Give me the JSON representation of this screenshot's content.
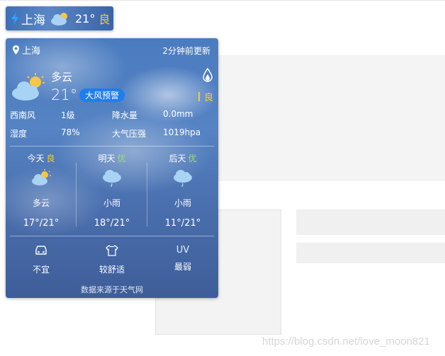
{
  "pill": {
    "city": "上海",
    "temp": "21°",
    "aqi": "良",
    "colors": {
      "aqi": "#f6d026",
      "bolt": "#2aa7ff"
    }
  },
  "card": {
    "location": "上海",
    "updated": "2分钟前更新",
    "condition": "多云",
    "temperature": "21°",
    "warning": "大风预警",
    "aqi": "良",
    "details": [
      {
        "label": "西南风",
        "value": "1级"
      },
      {
        "label": "降水量",
        "value": "0.0mm"
      },
      {
        "label": "湿度",
        "value": "78%"
      },
      {
        "label": "大气压强",
        "value": "1019hpa"
      }
    ],
    "forecast": [
      {
        "day": "今天",
        "quality": "良",
        "icon": "partly-cloudy-icon",
        "condition": "多云",
        "temp": "17°/21°"
      },
      {
        "day": "明天",
        "quality": "优",
        "icon": "light-rain-icon",
        "condition": "小雨",
        "temp": "18°/21°"
      },
      {
        "day": "后天",
        "quality": "优",
        "icon": "light-rain-icon",
        "condition": "小雨",
        "temp": "11°/21°"
      }
    ],
    "life": [
      {
        "icon": "car-icon",
        "label": "不宜"
      },
      {
        "icon": "shirt-icon",
        "label": "较舒适"
      },
      {
        "icon_text": "UV",
        "label": "最弱"
      }
    ],
    "source": "数据来源于天气网",
    "colors": {
      "warning": "#1e7df0",
      "good": "#f6d026",
      "excellent": "#9be36b"
    }
  },
  "watermark": "https://blog.csdn.net/love_moon821"
}
